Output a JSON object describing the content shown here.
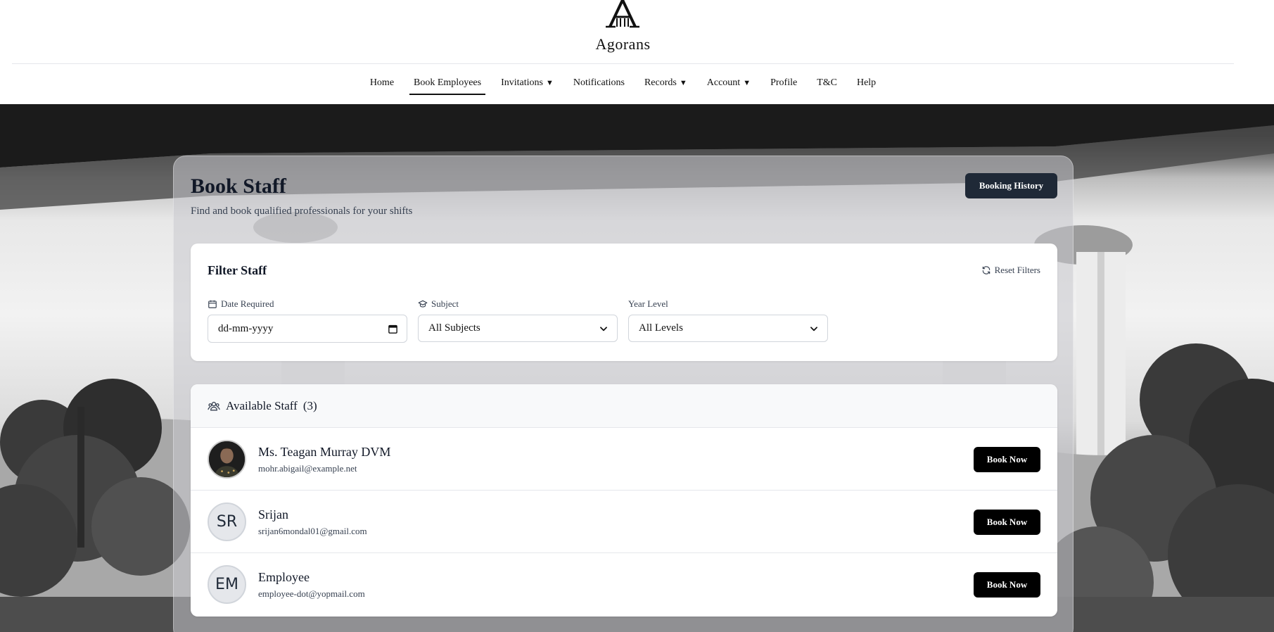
{
  "brand": {
    "name": "Agorans"
  },
  "nav": {
    "items": [
      {
        "label": "Home",
        "caret": ""
      },
      {
        "label": "Book Employees",
        "caret": "",
        "active": true
      },
      {
        "label": "Invitations",
        "caret": "▼"
      },
      {
        "label": "Notifications",
        "caret": ""
      },
      {
        "label": "Records",
        "caret": "▼"
      },
      {
        "label": "Account",
        "caret": "▼"
      },
      {
        "label": "Profile",
        "caret": ""
      },
      {
        "label": "T&C",
        "caret": ""
      },
      {
        "label": "Help",
        "caret": ""
      }
    ]
  },
  "page": {
    "title": "Book Staff",
    "subtitle": "Find and book qualified professionals for your shifts",
    "history_button": "Booking History"
  },
  "filter": {
    "title": "Filter Staff",
    "reset_label": "Reset Filters",
    "reset_icon": "refresh-icon",
    "date": {
      "label": "Date Required",
      "icon": "calendar-icon",
      "value": "dd-mm-yyyy"
    },
    "subject": {
      "label": "Subject",
      "icon": "graduation-cap-icon",
      "value": "All Subjects"
    },
    "year": {
      "label": "Year Level",
      "value": "All Levels"
    }
  },
  "staff": {
    "heading": "Available Staff",
    "count": "(3)",
    "icon": "users-icon",
    "book_label": "Book Now",
    "members": [
      {
        "name": "Ms. Teagan Murray DVM",
        "email": "mohr.abigail@example.net",
        "initials": "",
        "has_photo": true
      },
      {
        "name": "Srijan",
        "email": "srijan6mondal01@gmail.com",
        "initials": "SR",
        "has_photo": false
      },
      {
        "name": "Employee",
        "email": "employee-dot@yopmail.com",
        "initials": "EM",
        "has_photo": false
      }
    ]
  },
  "colors": {
    "primary_dark": "#1f2937",
    "button_black": "#000000",
    "text": "#111827",
    "muted": "#374151"
  }
}
